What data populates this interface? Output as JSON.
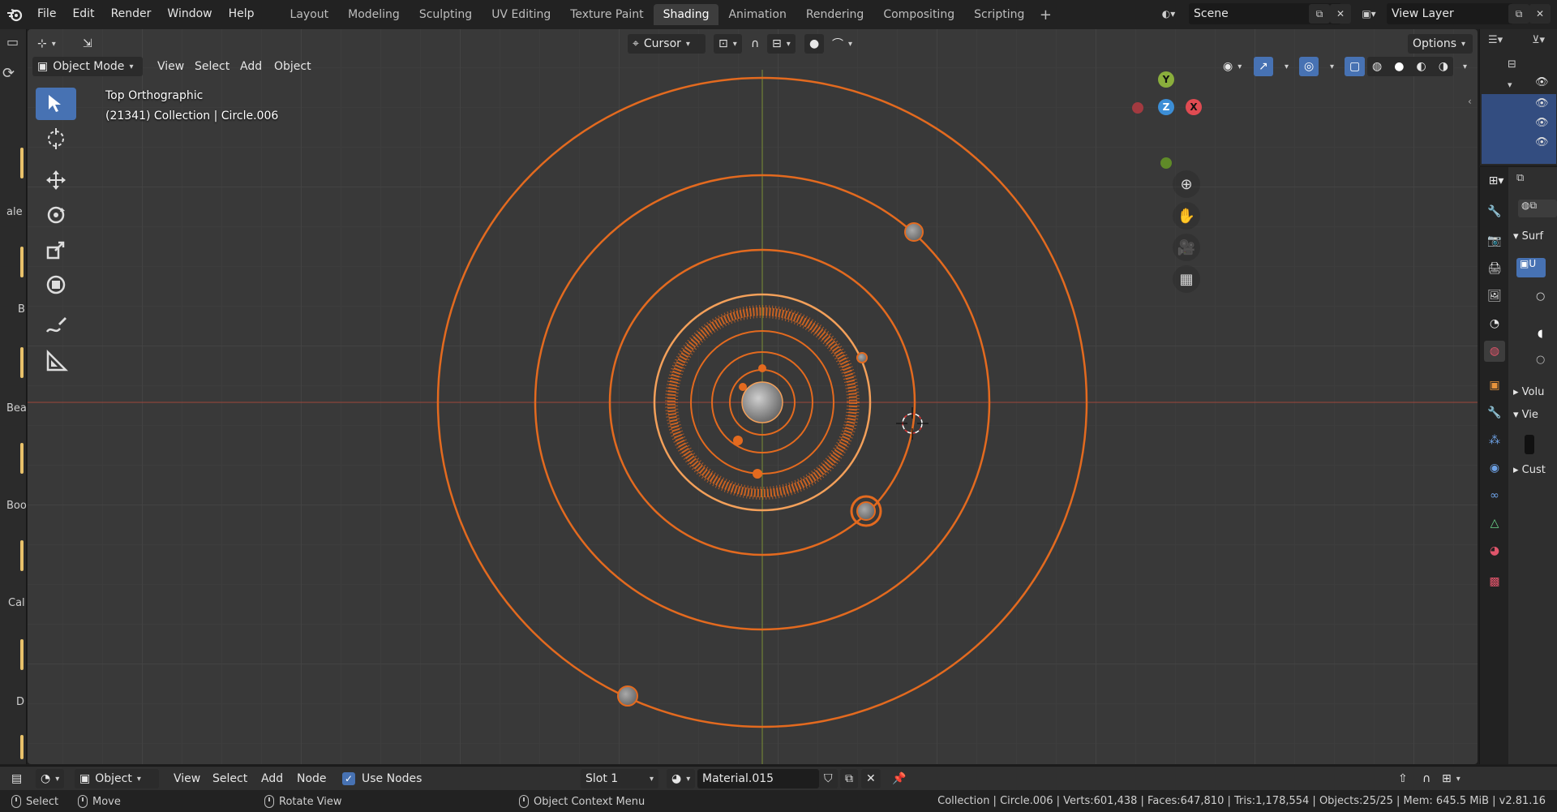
{
  "app": {
    "logo_icon": "blender-logo-icon"
  },
  "menubar": {
    "items": [
      "File",
      "Edit",
      "Render",
      "Window",
      "Help"
    ]
  },
  "workspaces": {
    "tabs": [
      "Layout",
      "Modeling",
      "Sculpting",
      "UV Editing",
      "Texture Paint",
      "Shading",
      "Animation",
      "Rendering",
      "Compositing",
      "Scripting"
    ],
    "active": "Shading",
    "add_icon": "plus-icon"
  },
  "scene": {
    "name": "Scene",
    "view_layer": "View Layer"
  },
  "left_strip": {
    "labels": [
      "ale",
      "B",
      "Bea",
      "Boo",
      "Cal",
      "D"
    ]
  },
  "viewport": {
    "header": {
      "transform_orientation": "Cursor",
      "options": "Options",
      "mode": "Object Mode",
      "menus": [
        "View",
        "Select",
        "Add",
        "Object"
      ]
    },
    "info": {
      "view_name": "Top Orthographic",
      "context": "(21341) Collection | Circle.006"
    },
    "gizmo": {
      "y": "Y",
      "x": "X",
      "z": "Z"
    },
    "colors": {
      "selected": "#e36a1f",
      "active": "#f3a05a",
      "axis_x": "#c64c4c",
      "axis_y": "#8aae3c",
      "cursor": "#ffffff"
    }
  },
  "toolbar": {
    "tools": [
      "select-box-icon",
      "cursor-icon",
      "move-icon",
      "rotate-icon",
      "scale-icon",
      "transform-icon",
      "annotate-icon",
      "measure-icon"
    ]
  },
  "properties": {
    "sections": [
      "Surf",
      "Volu",
      "Vie",
      "Cust"
    ],
    "material_short": "U"
  },
  "shader_editor": {
    "editor_icon": "shader-editor-icon",
    "object_type": "Object",
    "menus": [
      "View",
      "Select",
      "Add",
      "Node"
    ],
    "use_nodes_label": "Use Nodes",
    "use_nodes": true,
    "slot": "Slot 1",
    "material": "Material.015"
  },
  "statusbar": {
    "select": "Select",
    "move": "Move",
    "rotate": "Rotate View",
    "context_menu": "Object Context Menu",
    "stats": "Collection | Circle.006 | Verts:601,438 | Faces:647,810 | Tris:1,178,554 | Objects:25/25 | Mem: 645.5 MiB | v2.81.16"
  }
}
